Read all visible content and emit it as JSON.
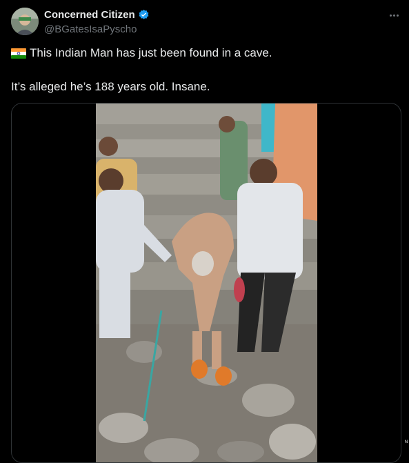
{
  "author": {
    "display_name": "Concerned Citizen",
    "handle": "@BGatesIsaPyscho",
    "verified": true,
    "avatar_icon": "profile-avatar-icon"
  },
  "post": {
    "flag_icon": "india-flag-icon",
    "line1": "This Indian Man has just been found in a cave.",
    "line2": "It’s alleged he’s 188 years old.  Insane."
  },
  "media": {
    "icon": "video-photo-icon",
    "corner_glyph": "ᴺ"
  },
  "colors": {
    "background": "#000000",
    "text": "#e7e9ea",
    "secondary": "#71767b",
    "verified_blue": "#1d9bf0",
    "border": "#2f3336"
  }
}
